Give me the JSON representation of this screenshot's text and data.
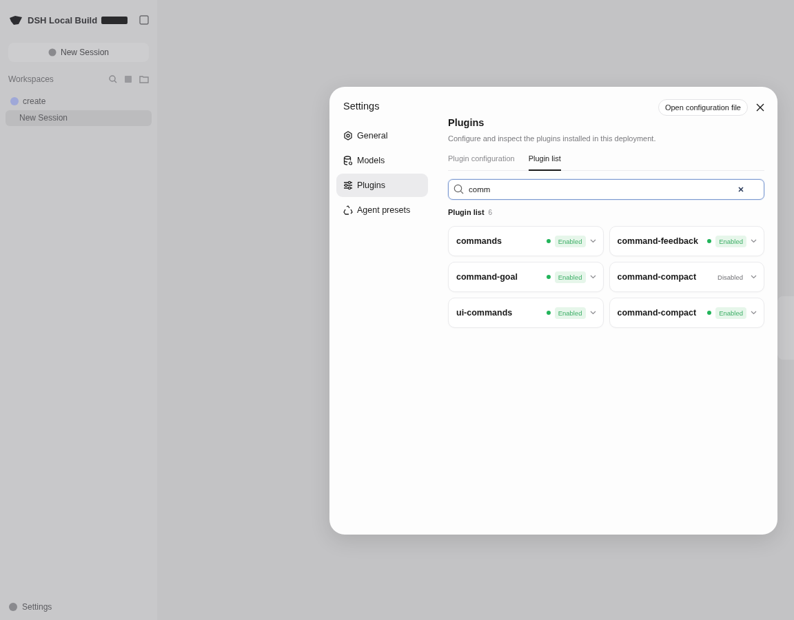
{
  "sidebar": {
    "app_title": "DSH Local Build",
    "new_session_button": "New Session",
    "workspaces_label": "Workspaces",
    "workspaces": [
      {
        "name": "create",
        "sessions": [
          {
            "title": "New Session",
            "selected": true
          }
        ]
      }
    ],
    "settings_link": "Settings"
  },
  "dialog": {
    "title": "Settings",
    "open_config_button": "Open configuration file",
    "nav": [
      {
        "label": "General",
        "selected": false
      },
      {
        "label": "Models",
        "selected": false
      },
      {
        "label": "Plugins",
        "selected": true
      },
      {
        "label": "Agent presets",
        "selected": false
      }
    ],
    "heading": "Plugins",
    "description": "Configure and inspect the plugins installed in this deployment.",
    "tabs": [
      {
        "label": "Plugin configuration",
        "selected": false
      },
      {
        "label": "Plugin list",
        "selected": true
      }
    ],
    "search": {
      "value": "comm"
    },
    "list_label": "Plugin list",
    "list_count": "6",
    "plugins": [
      {
        "name": "commands",
        "enabled": true,
        "status": "Enabled"
      },
      {
        "name": "command-feedback",
        "enabled": true,
        "status": "Enabled"
      },
      {
        "name": "command-goal",
        "enabled": true,
        "status": "Enabled"
      },
      {
        "name": "command-compact",
        "enabled": false,
        "status": "Disabled"
      },
      {
        "name": "ui-commands",
        "enabled": true,
        "status": "Enabled"
      },
      {
        "name": "command-compact",
        "enabled": true,
        "status": "Enabled"
      }
    ]
  }
}
